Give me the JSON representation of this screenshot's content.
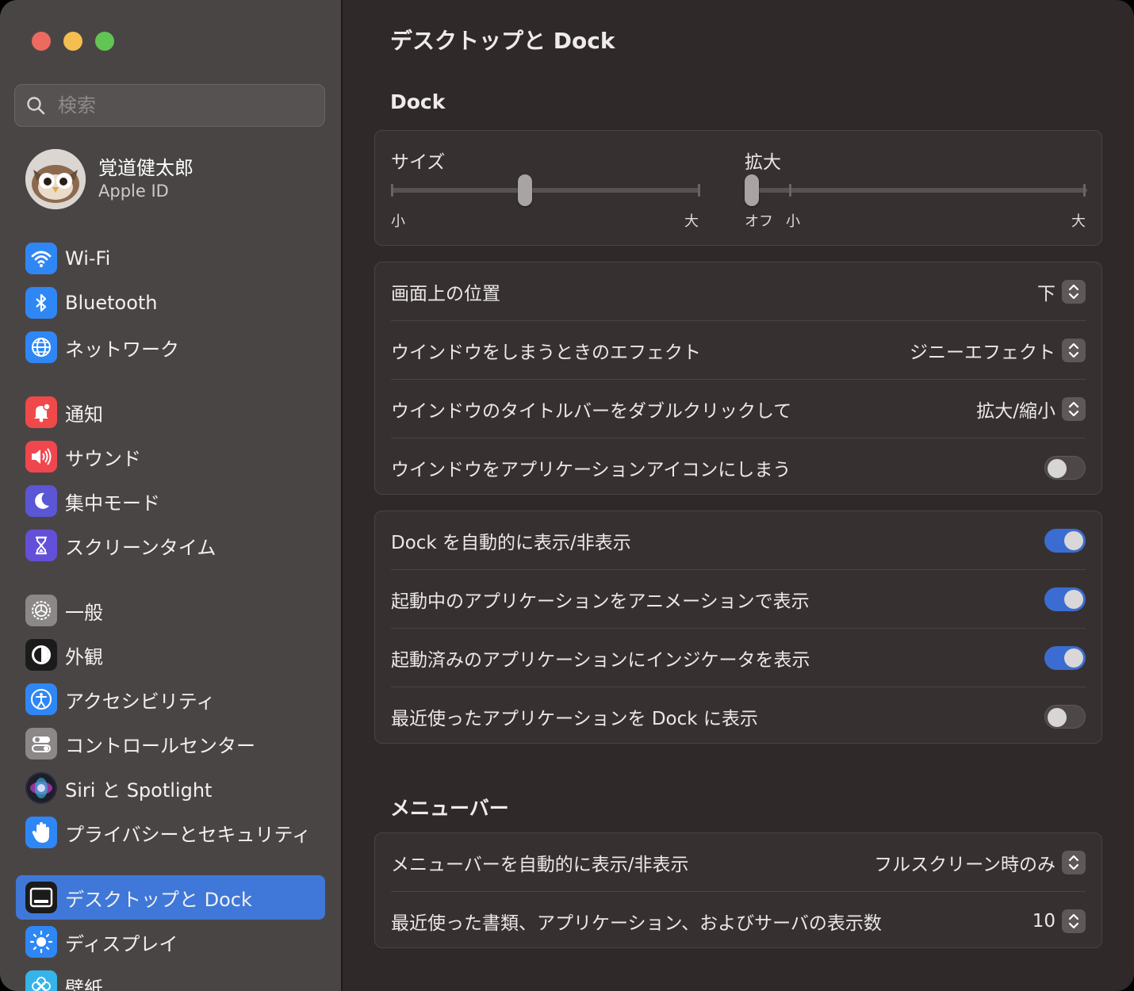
{
  "sidebar": {
    "search_placeholder": "検索",
    "profile": {
      "name": "覚道健太郎",
      "sub": "Apple ID"
    },
    "items": [
      {
        "label": "Wi-Fi",
        "icon": "wifi-icon",
        "color": "#2f87f5"
      },
      {
        "label": "Bluetooth",
        "icon": "bluetooth-icon",
        "color": "#2f87f5"
      },
      {
        "label": "ネットワーク",
        "icon": "globe-icon",
        "color": "#2f87f5"
      },
      {
        "label": "通知",
        "icon": "bell-icon",
        "color": "#f0494a"
      },
      {
        "label": "サウンド",
        "icon": "speaker-icon",
        "color": "#f0474f"
      },
      {
        "label": "集中モード",
        "icon": "moon-icon",
        "color": "#5b56d6"
      },
      {
        "label": "スクリーンタイム",
        "icon": "hourglass-icon",
        "color": "#6350d9"
      },
      {
        "label": "一般",
        "icon": "gear-icon",
        "color": "#8c8888"
      },
      {
        "label": "外観",
        "icon": "appearance-icon",
        "color": "#1b1b1b"
      },
      {
        "label": "アクセシビリティ",
        "icon": "accessibility-icon",
        "color": "#2f87f5"
      },
      {
        "label": "コントロールセンター",
        "icon": "control-center-icon",
        "color": "#8c8888"
      },
      {
        "label": "Siri と Spotlight",
        "icon": "siri-icon",
        "color": "#2a2a3a"
      },
      {
        "label": "プライバシーとセキュリティ",
        "icon": "hand-icon",
        "color": "#2f87f5"
      },
      {
        "label": "デスクトップと Dock",
        "icon": "dock-icon",
        "color": "#1b1b1b"
      },
      {
        "label": "ディスプレイ",
        "icon": "sun-icon",
        "color": "#2f87f5"
      },
      {
        "label": "壁紙",
        "icon": "wallpaper-icon",
        "color": "#36b3e8"
      }
    ]
  },
  "main": {
    "title": "デスクトップと Dock",
    "dock_section": "Dock",
    "size_slider": {
      "label": "サイズ",
      "min_label": "小",
      "max_label": "大",
      "value": 0.43
    },
    "magnify_slider": {
      "label": "拡大",
      "off_label": "オフ",
      "min_label": "小",
      "max_label": "大",
      "value": 0
    },
    "group1": [
      {
        "label": "画面上の位置",
        "type": "select",
        "value": "下"
      },
      {
        "label": "ウインドウをしまうときのエフェクト",
        "type": "select",
        "value": "ジニーエフェクト"
      },
      {
        "label": "ウインドウのタイトルバーをダブルクリックして",
        "type": "select",
        "value": "拡大/縮小"
      },
      {
        "label": "ウインドウをアプリケーションアイコンにしまう",
        "type": "toggle",
        "on": false
      }
    ],
    "group2": [
      {
        "label": "Dock を自動的に表示/非表示",
        "type": "toggle",
        "on": true
      },
      {
        "label": "起動中のアプリケーションをアニメーションで表示",
        "type": "toggle",
        "on": true
      },
      {
        "label": "起動済みのアプリケーションにインジケータを表示",
        "type": "toggle",
        "on": true
      },
      {
        "label": "最近使ったアプリケーションを Dock に表示",
        "type": "toggle",
        "on": false
      }
    ],
    "menubar_section": "メニューバー",
    "group3": [
      {
        "label": "メニューバーを自動的に表示/非表示",
        "type": "select",
        "value": "フルスクリーン時のみ"
      },
      {
        "label": "最近使った書類、アプリケーション、およびサーバの表示数",
        "type": "select",
        "value": "10"
      }
    ]
  }
}
